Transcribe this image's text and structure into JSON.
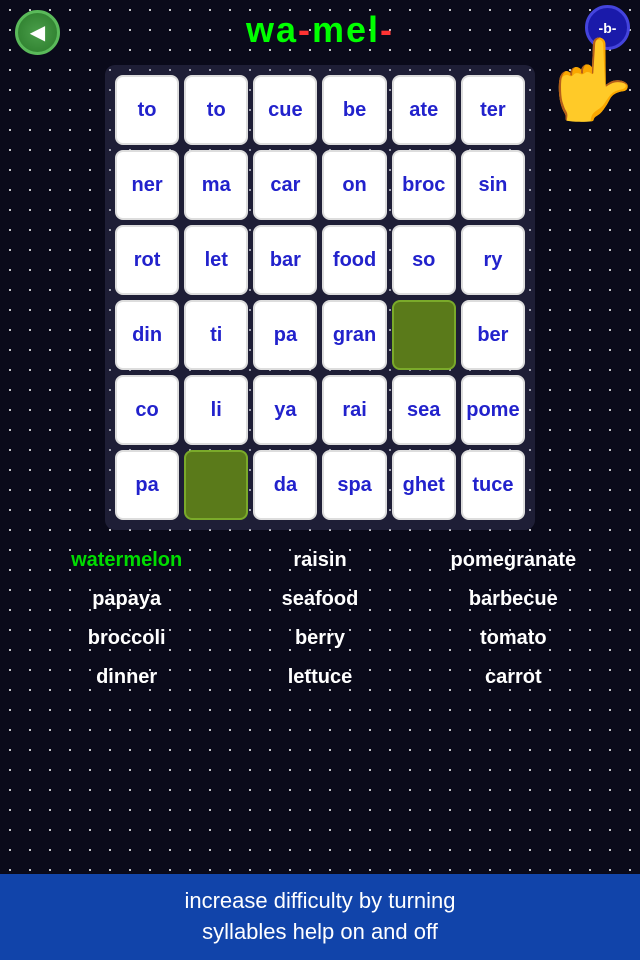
{
  "header": {
    "title_wa": "wa",
    "title_dash1": "-",
    "title_mel": "mel",
    "title_dash2": "-",
    "level": "-b-",
    "back_label": "◀"
  },
  "grid": {
    "rows": [
      [
        "to",
        "to",
        "cue",
        "be",
        "ate",
        "ter"
      ],
      [
        "ner",
        "ma",
        "car",
        "on",
        "broc",
        "sin"
      ],
      [
        "rot",
        "let",
        "bar",
        "food",
        "so",
        "ry"
      ],
      [
        "din",
        "ti",
        "pa",
        "gran",
        "GREEN",
        "ber"
      ],
      [
        "co",
        "li",
        "ya",
        "rai",
        "sea",
        "pome"
      ],
      [
        "pa",
        "GREEN",
        "da",
        "spa",
        "ghet",
        "tuce"
      ]
    ]
  },
  "words": [
    {
      "text": "watermelon",
      "highlight": true
    },
    {
      "text": "raisin",
      "highlight": false
    },
    {
      "text": "pomegranate",
      "highlight": false
    },
    {
      "text": "papaya",
      "highlight": false
    },
    {
      "text": "seafood",
      "highlight": false
    },
    {
      "text": "barbecue",
      "highlight": false
    },
    {
      "text": "broccoli",
      "highlight": false
    },
    {
      "text": "berry",
      "highlight": false
    },
    {
      "text": "tomato",
      "highlight": false
    },
    {
      "text": "dinner",
      "highlight": false
    },
    {
      "text": "lettuce",
      "highlight": false
    },
    {
      "text": "carrot",
      "highlight": false
    }
  ],
  "banner": {
    "line1": "increase difficulty by turning",
    "line2": "syllables help on and off"
  },
  "icons": {
    "back": "◀",
    "hand": "👆"
  }
}
